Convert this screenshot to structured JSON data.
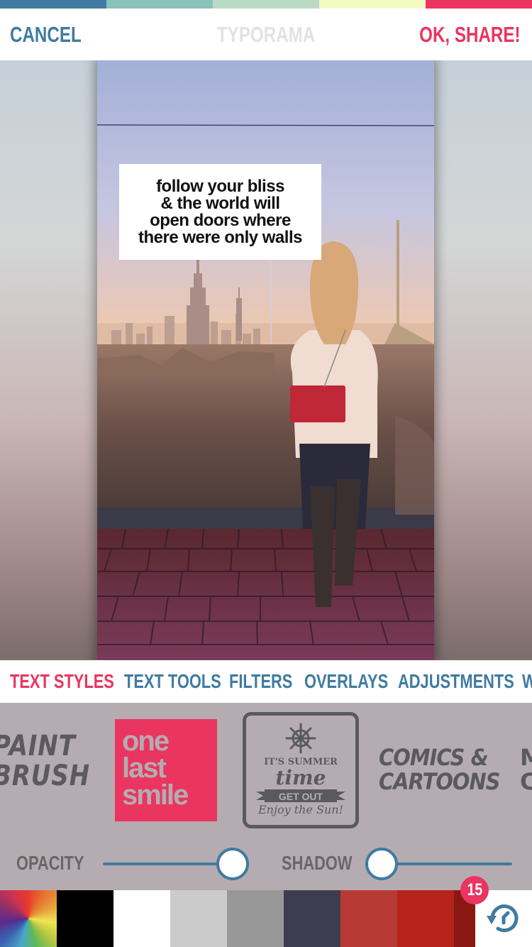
{
  "top_strip": {
    "colors": [
      "#417aa0",
      "#89c2b8",
      "#bbdac5",
      "#f3fbc1",
      "#ea3560"
    ]
  },
  "header": {
    "cancel_label": "CANCEL",
    "title": "TYPORAMA",
    "share_label": "OK, SHARE!"
  },
  "canvas": {
    "quote_lines": [
      "follow your bliss",
      "& the world will",
      "open doors where",
      "there were only walls"
    ]
  },
  "tabs": [
    {
      "label": "TEXT STYLES",
      "active": true
    },
    {
      "label": "TEXT TOOLS",
      "active": false
    },
    {
      "label": "FILTERS",
      "active": false
    },
    {
      "label": "OVERLAYS",
      "active": false
    },
    {
      "label": "ADJUSTMENTS",
      "active": false
    },
    {
      "label": "W",
      "active": false
    }
  ],
  "styles": {
    "paint_brush": {
      "line1": "PAINT",
      "line2": "BRUSH"
    },
    "one_last_smile": {
      "line1": "one",
      "line2": "last",
      "line3": "smile"
    },
    "summer": {
      "line1": "IT'S SUMMER",
      "line2": "time",
      "line3": "GET OUT",
      "line4": "Enjoy the Sun!"
    },
    "comics": {
      "line1": "COMICS &",
      "line2": "CARTOONS"
    },
    "next": {
      "line1": "M",
      "line2": "C"
    }
  },
  "sliders": {
    "opacity": {
      "label": "OPACITY",
      "value": 1.0
    },
    "shadow": {
      "label": "SHADOW",
      "value": 0.0
    }
  },
  "swatches": [
    {
      "name": "color-wheel",
      "color": "wheel"
    },
    {
      "name": "black",
      "color": "#000000"
    },
    {
      "name": "white",
      "color": "#ffffff"
    },
    {
      "name": "light-gray",
      "color": "#cbcbcb"
    },
    {
      "name": "gray",
      "color": "#989898"
    },
    {
      "name": "dark-slate",
      "color": "#3e3c50"
    },
    {
      "name": "brick-red",
      "color": "#b83a35"
    },
    {
      "name": "red",
      "color": "#b5231a"
    },
    {
      "name": "dark-red",
      "color": "#8a1812"
    }
  ],
  "undo": {
    "badge_count": "15"
  },
  "colors": {
    "accent_pink": "#ea3560",
    "accent_blue": "#407ba0",
    "panel_bg": "#b5acb1"
  }
}
